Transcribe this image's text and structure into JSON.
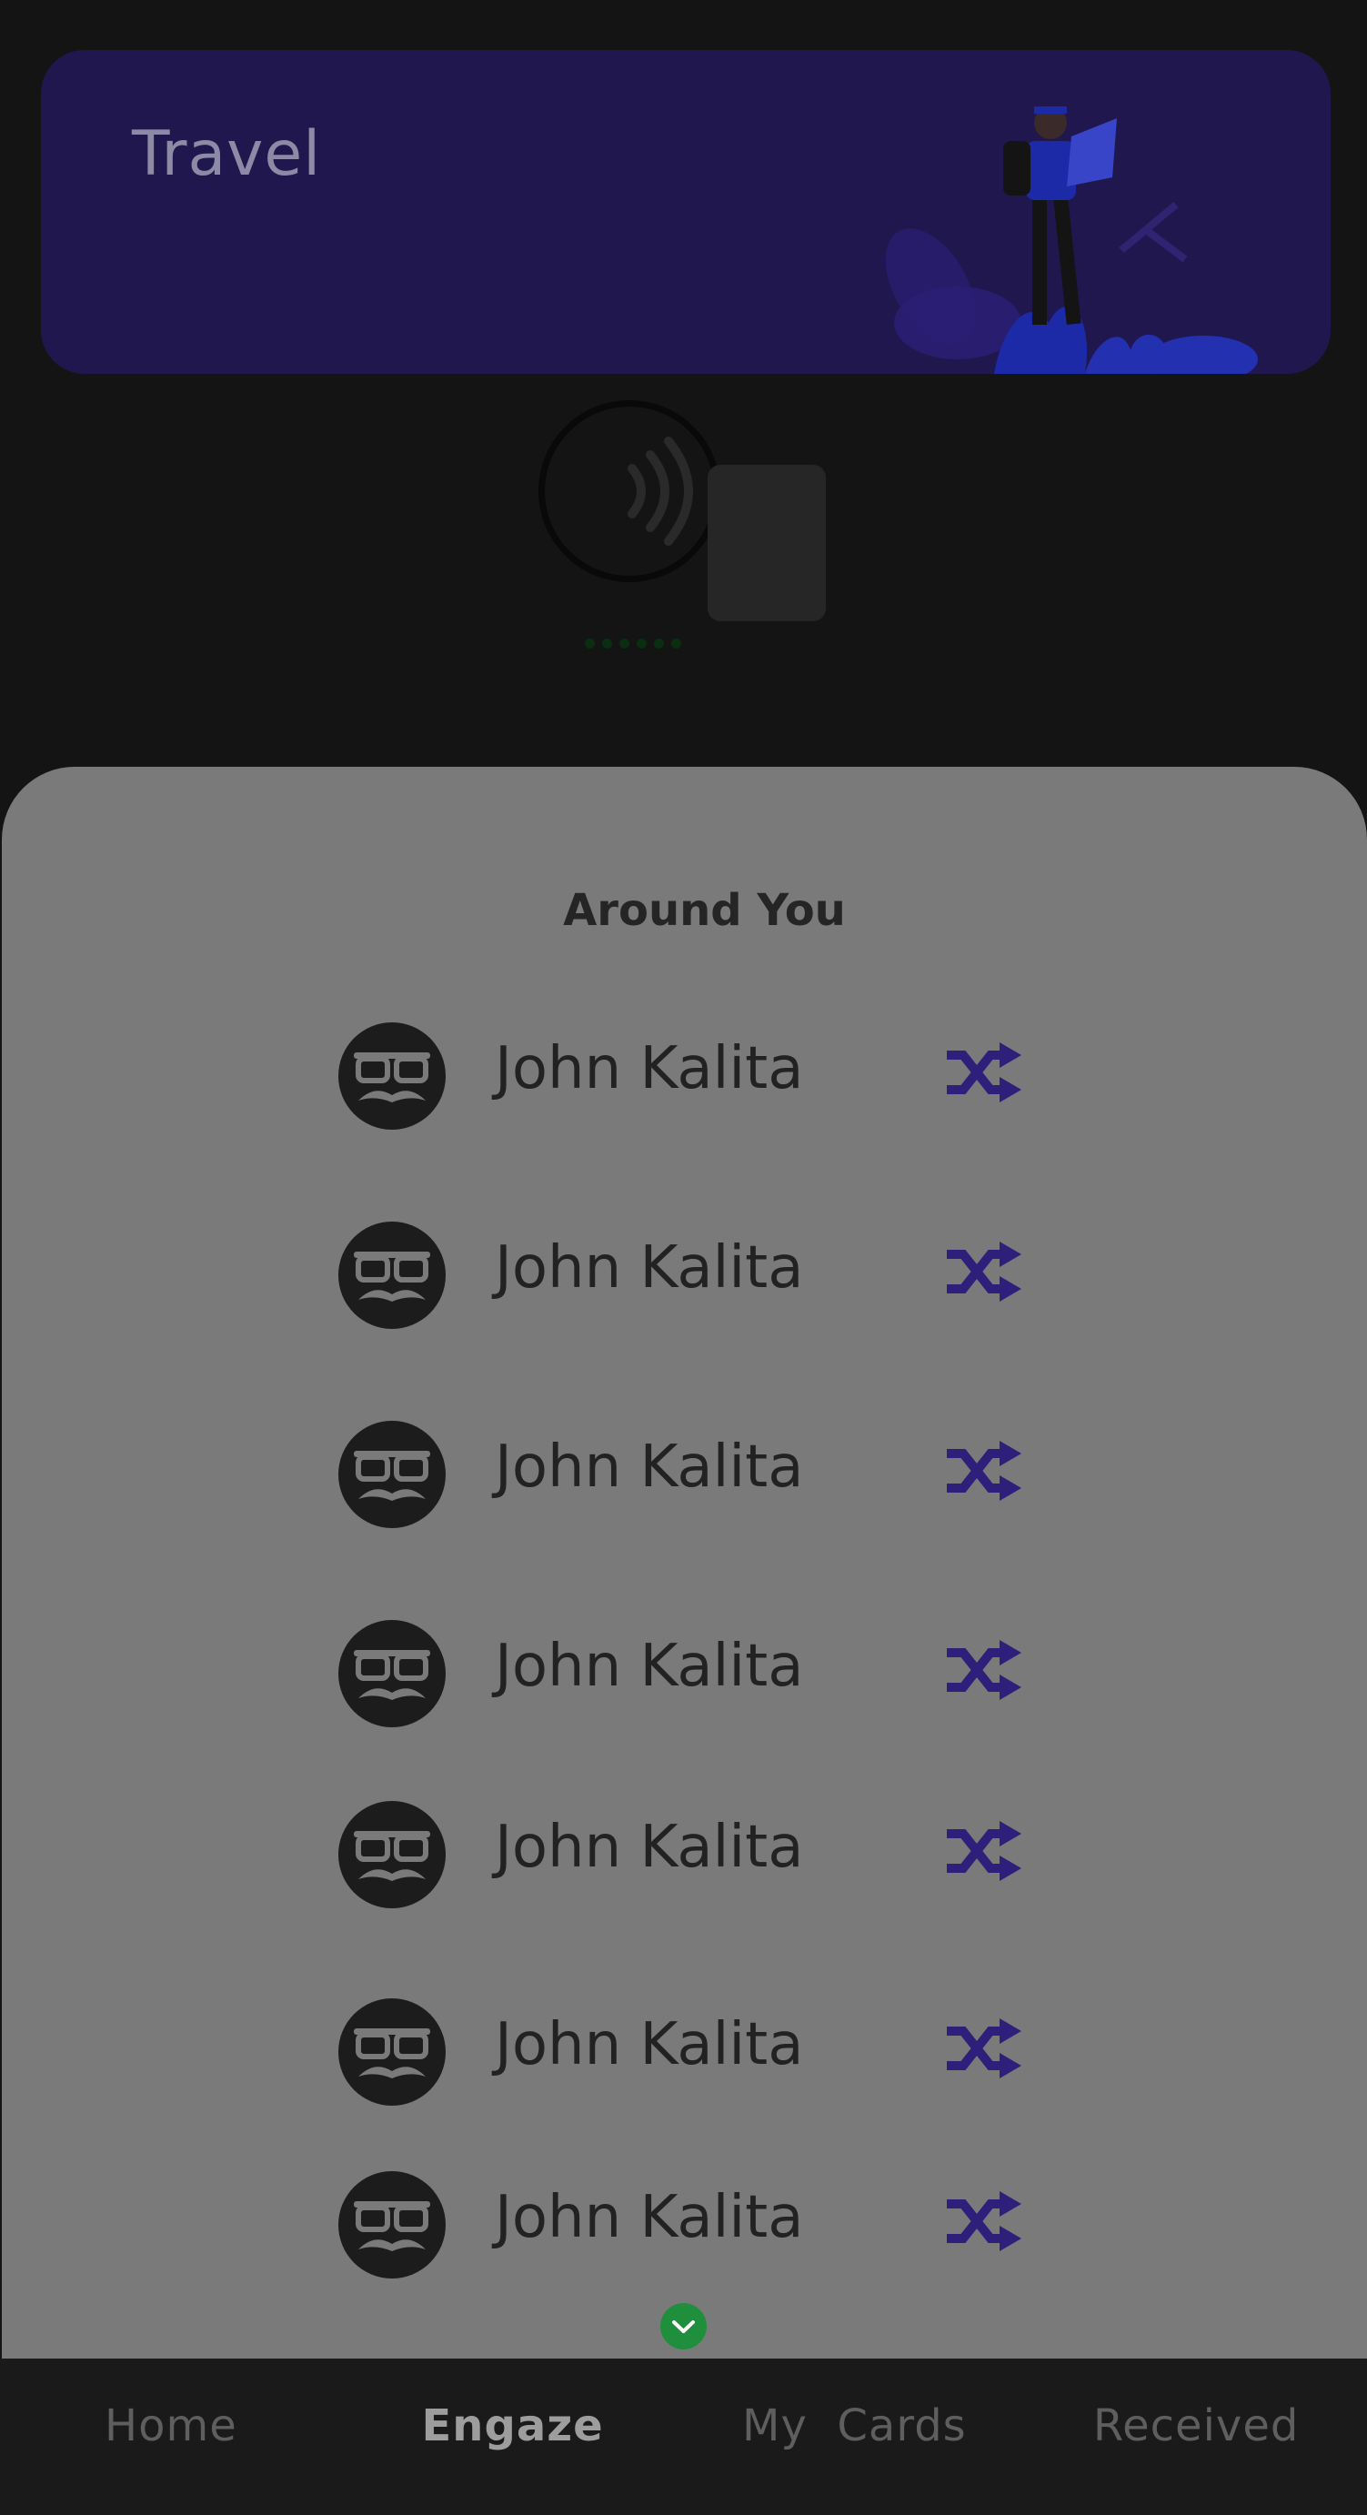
{
  "banner": {
    "title": "Travel"
  },
  "sheet": {
    "title": "Around You",
    "people": [
      {
        "name": "John Kalita"
      },
      {
        "name": "John Kalita"
      },
      {
        "name": "John Kalita"
      },
      {
        "name": "John Kalita"
      },
      {
        "name": "John Kalita"
      },
      {
        "name": "John Kalita"
      },
      {
        "name": "John Kalita"
      }
    ]
  },
  "nav": {
    "items": [
      {
        "label": "Home"
      },
      {
        "label": "Engaze"
      },
      {
        "label": "My  Cards"
      },
      {
        "label": "Received"
      }
    ],
    "active_index": 1
  },
  "colors": {
    "banner": "#21174f",
    "accent": "#2d1f7a",
    "sheet": "#7a7a7a",
    "expand": "#1f8f3e"
  },
  "icons": {
    "avatar": "incognito-mustache-glasses-icon",
    "row_action": "shuffle-swap-icon",
    "expand": "chevron-down-icon",
    "nfc": "nfc-tap-icon"
  }
}
